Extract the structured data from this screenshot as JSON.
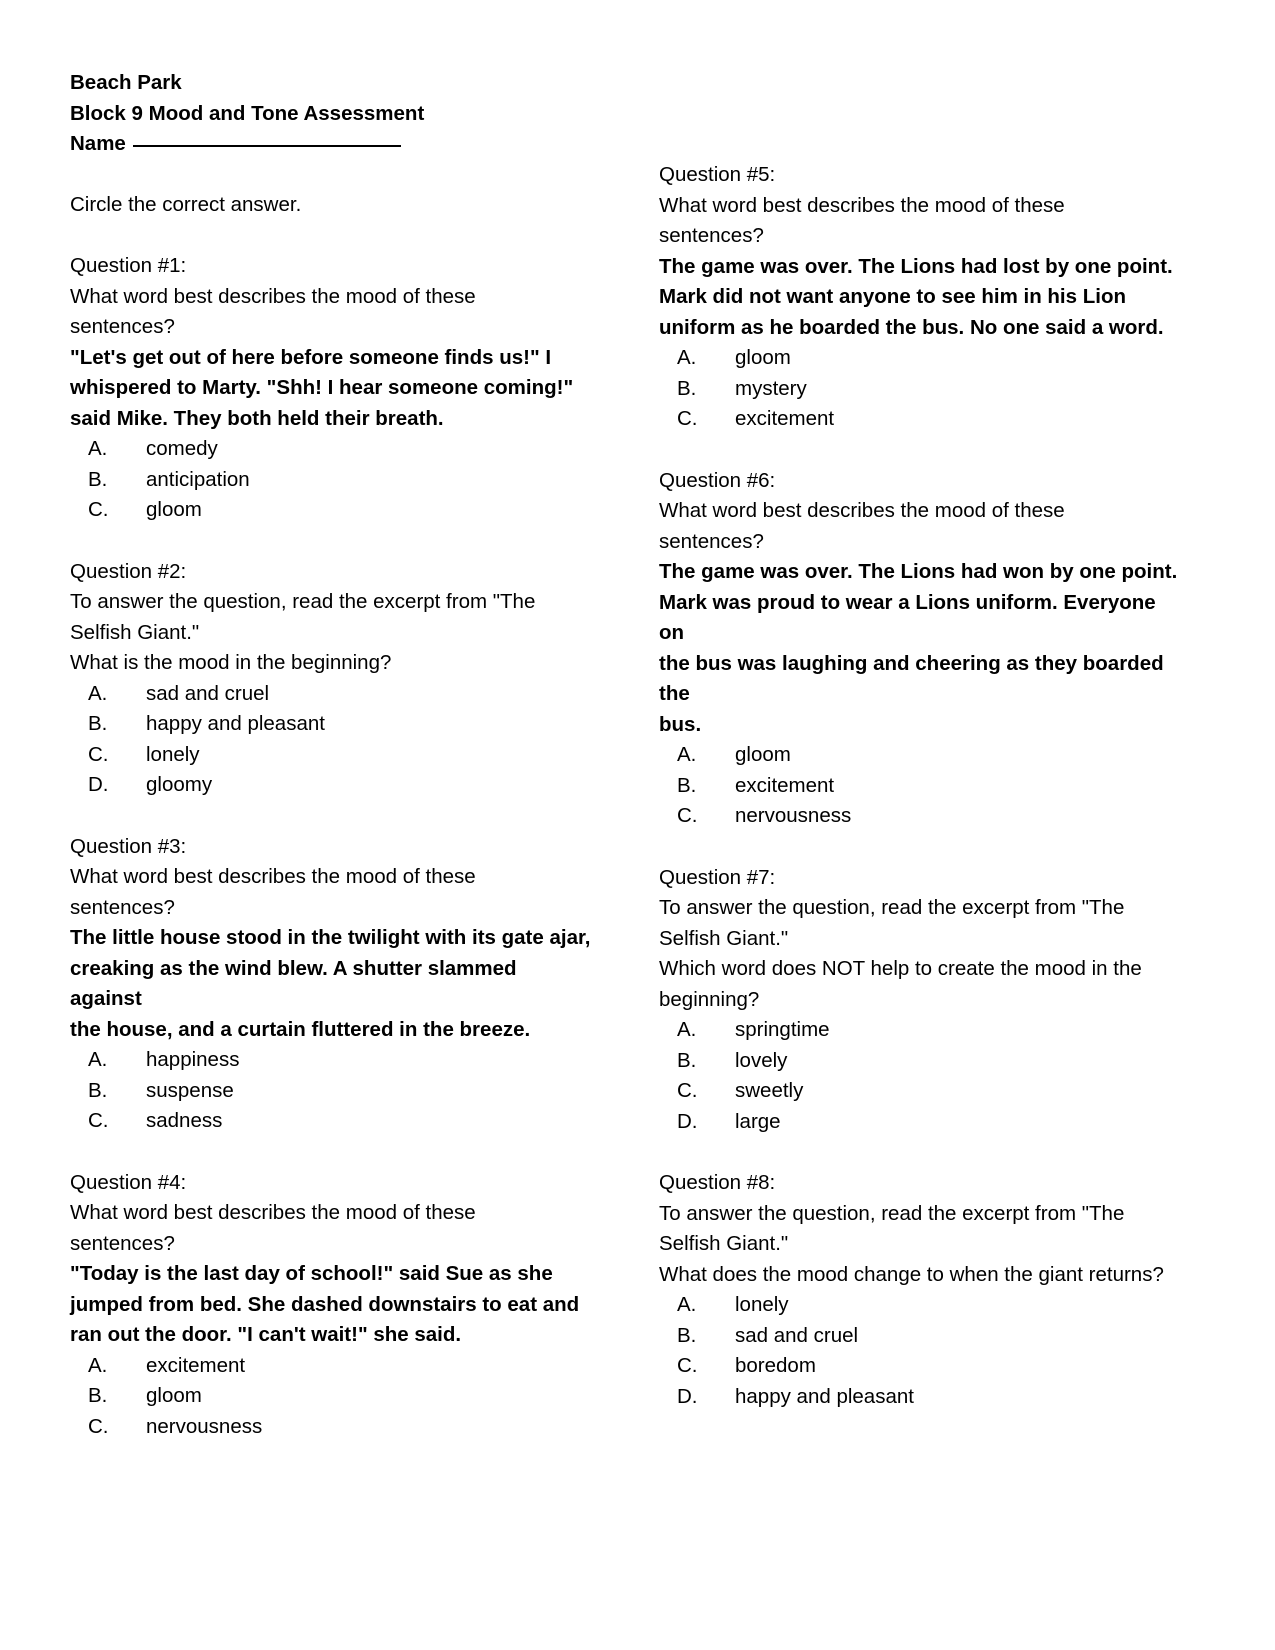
{
  "header": {
    "school": "Beach Park",
    "assessment_title": "Block 9 Mood and Tone Assessment",
    "name_label": "Name",
    "instruction": "Circle the correct answer."
  },
  "left_column": [
    {
      "number": "Question #1:",
      "prompt_lines": [
        "What word best describes the mood of these",
        "sentences?"
      ],
      "passage_lines": [
        "\"Let's get out of here before someone finds us!\" I",
        "whispered to Marty. \"Shh! I hear someone coming!\"",
        "said Mike. They both held their breath."
      ],
      "options": [
        {
          "letter": "A.",
          "text": "comedy"
        },
        {
          "letter": "B.",
          "text": "anticipation"
        },
        {
          "letter": "C.",
          "text": "gloom"
        }
      ]
    },
    {
      "number": "Question #2:",
      "prompt_lines": [
        "To answer the question, read the excerpt from \"The",
        "Selfish Giant.\"",
        "What is the mood in the beginning?"
      ],
      "passage_lines": [],
      "options": [
        {
          "letter": "A.",
          "text": "sad and cruel"
        },
        {
          "letter": "B.",
          "text": "happy and pleasant"
        },
        {
          "letter": "C.",
          "text": "lonely"
        },
        {
          "letter": "D.",
          "text": "gloomy"
        }
      ]
    },
    {
      "number": "Question #3:",
      "prompt_lines": [
        "What word best describes the mood of these",
        "sentences?"
      ],
      "passage_lines": [
        "The little house stood in the twilight with its gate ajar,",
        "creaking as the wind blew. A shutter slammed against",
        "the house, and a curtain fluttered in the breeze."
      ],
      "options": [
        {
          "letter": "A.",
          "text": "happiness"
        },
        {
          "letter": "B.",
          "text": "suspense"
        },
        {
          "letter": "C.",
          "text": "sadness"
        }
      ]
    },
    {
      "number": "Question #4:",
      "prompt_lines": [
        "What word best describes the mood of these",
        "sentences?"
      ],
      "passage_lines": [
        "\"Today is the last day of school!\" said Sue as she",
        "jumped from bed. She dashed downstairs to eat and",
        "ran out the door. \"I can't wait!\" she said."
      ],
      "options": [
        {
          "letter": "A.",
          "text": "excitement"
        },
        {
          "letter": "B.",
          "text": "gloom"
        },
        {
          "letter": "C.",
          "text": "nervousness"
        }
      ]
    }
  ],
  "right_column": [
    {
      "number": "Question #5:",
      "prompt_lines": [
        "What word best describes the mood of these",
        "sentences?"
      ],
      "passage_lines": [
        "The game was over. The Lions had lost by one point.",
        "Mark did not want anyone to see him in his Lion",
        "uniform as he boarded the bus. No one said a word."
      ],
      "options": [
        {
          "letter": "A.",
          "text": "gloom"
        },
        {
          "letter": "B.",
          "text": "mystery"
        },
        {
          "letter": "C.",
          "text": "excitement"
        }
      ]
    },
    {
      "number": "Question #6:",
      "prompt_lines": [
        "What word best describes the mood of these",
        "sentences?"
      ],
      "passage_lines": [
        "The game was over. The Lions had won by one point.",
        "Mark was proud to wear a Lions uniform. Everyone on",
        "the bus was laughing and cheering as they boarded the",
        "bus."
      ],
      "options": [
        {
          "letter": "A.",
          "text": "gloom"
        },
        {
          "letter": "B.",
          "text": "excitement"
        },
        {
          "letter": "C.",
          "text": "nervousness"
        }
      ]
    },
    {
      "number": "Question #7:",
      "prompt_lines": [
        "To answer the question, read the excerpt from \"The",
        "Selfish Giant.\"",
        "Which word does NOT help to create the mood in the",
        "beginning?"
      ],
      "passage_lines": [],
      "options": [
        {
          "letter": "A.",
          "text": "springtime"
        },
        {
          "letter": "B.",
          "text": "lovely"
        },
        {
          "letter": "C.",
          "text": "sweetly"
        },
        {
          "letter": "D.",
          "text": "large"
        }
      ]
    },
    {
      "number": "Question #8:",
      "prompt_lines": [
        "To answer the question, read the excerpt from \"The",
        "Selfish Giant.\"",
        "What does the mood change to when the giant returns?"
      ],
      "passage_lines": [],
      "options": [
        {
          "letter": "A.",
          "text": "lonely"
        },
        {
          "letter": "B.",
          "text": "sad and cruel"
        },
        {
          "letter": "C.",
          "text": "boredom"
        },
        {
          "letter": "D.",
          "text": "happy and pleasant"
        }
      ]
    }
  ]
}
